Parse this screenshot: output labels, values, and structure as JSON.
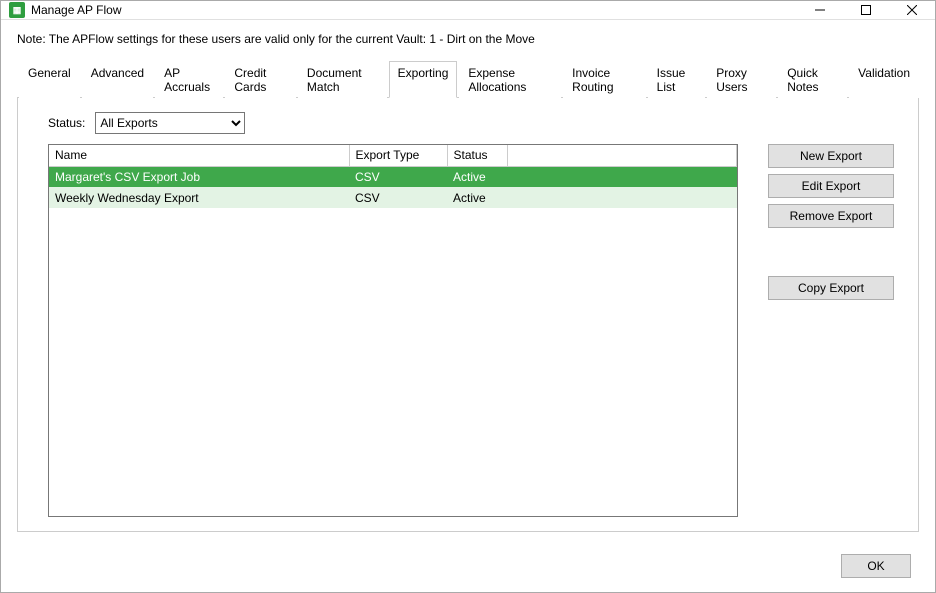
{
  "window": {
    "title": "Manage AP Flow"
  },
  "note": "Note:  The APFlow settings for these users are valid only for the current Vault: 1 - Dirt on the Move",
  "tabs": [
    {
      "label": "General"
    },
    {
      "label": "Advanced"
    },
    {
      "label": "AP Accruals"
    },
    {
      "label": "Credit Cards"
    },
    {
      "label": "Document Match"
    },
    {
      "label": "Exporting"
    },
    {
      "label": "Expense Allocations"
    },
    {
      "label": "Invoice Routing"
    },
    {
      "label": "Issue List"
    },
    {
      "label": "Proxy Users"
    },
    {
      "label": "Quick Notes"
    },
    {
      "label": "Validation"
    }
  ],
  "activeTabIndex": 5,
  "status": {
    "label": "Status:",
    "selected": "All Exports"
  },
  "table": {
    "headers": {
      "name": "Name",
      "exportType": "Export Type",
      "status": "Status"
    },
    "rows": [
      {
        "name": "Margaret's CSV Export Job",
        "exportType": "CSV",
        "status": "Active",
        "selected": true
      },
      {
        "name": "Weekly Wednesday Export",
        "exportType": "CSV",
        "status": "Active",
        "selected": false
      }
    ]
  },
  "buttons": {
    "newExport": "New Export",
    "editExport": "Edit Export",
    "removeExport": "Remove Export",
    "copyExport": "Copy Export",
    "ok": "OK"
  }
}
